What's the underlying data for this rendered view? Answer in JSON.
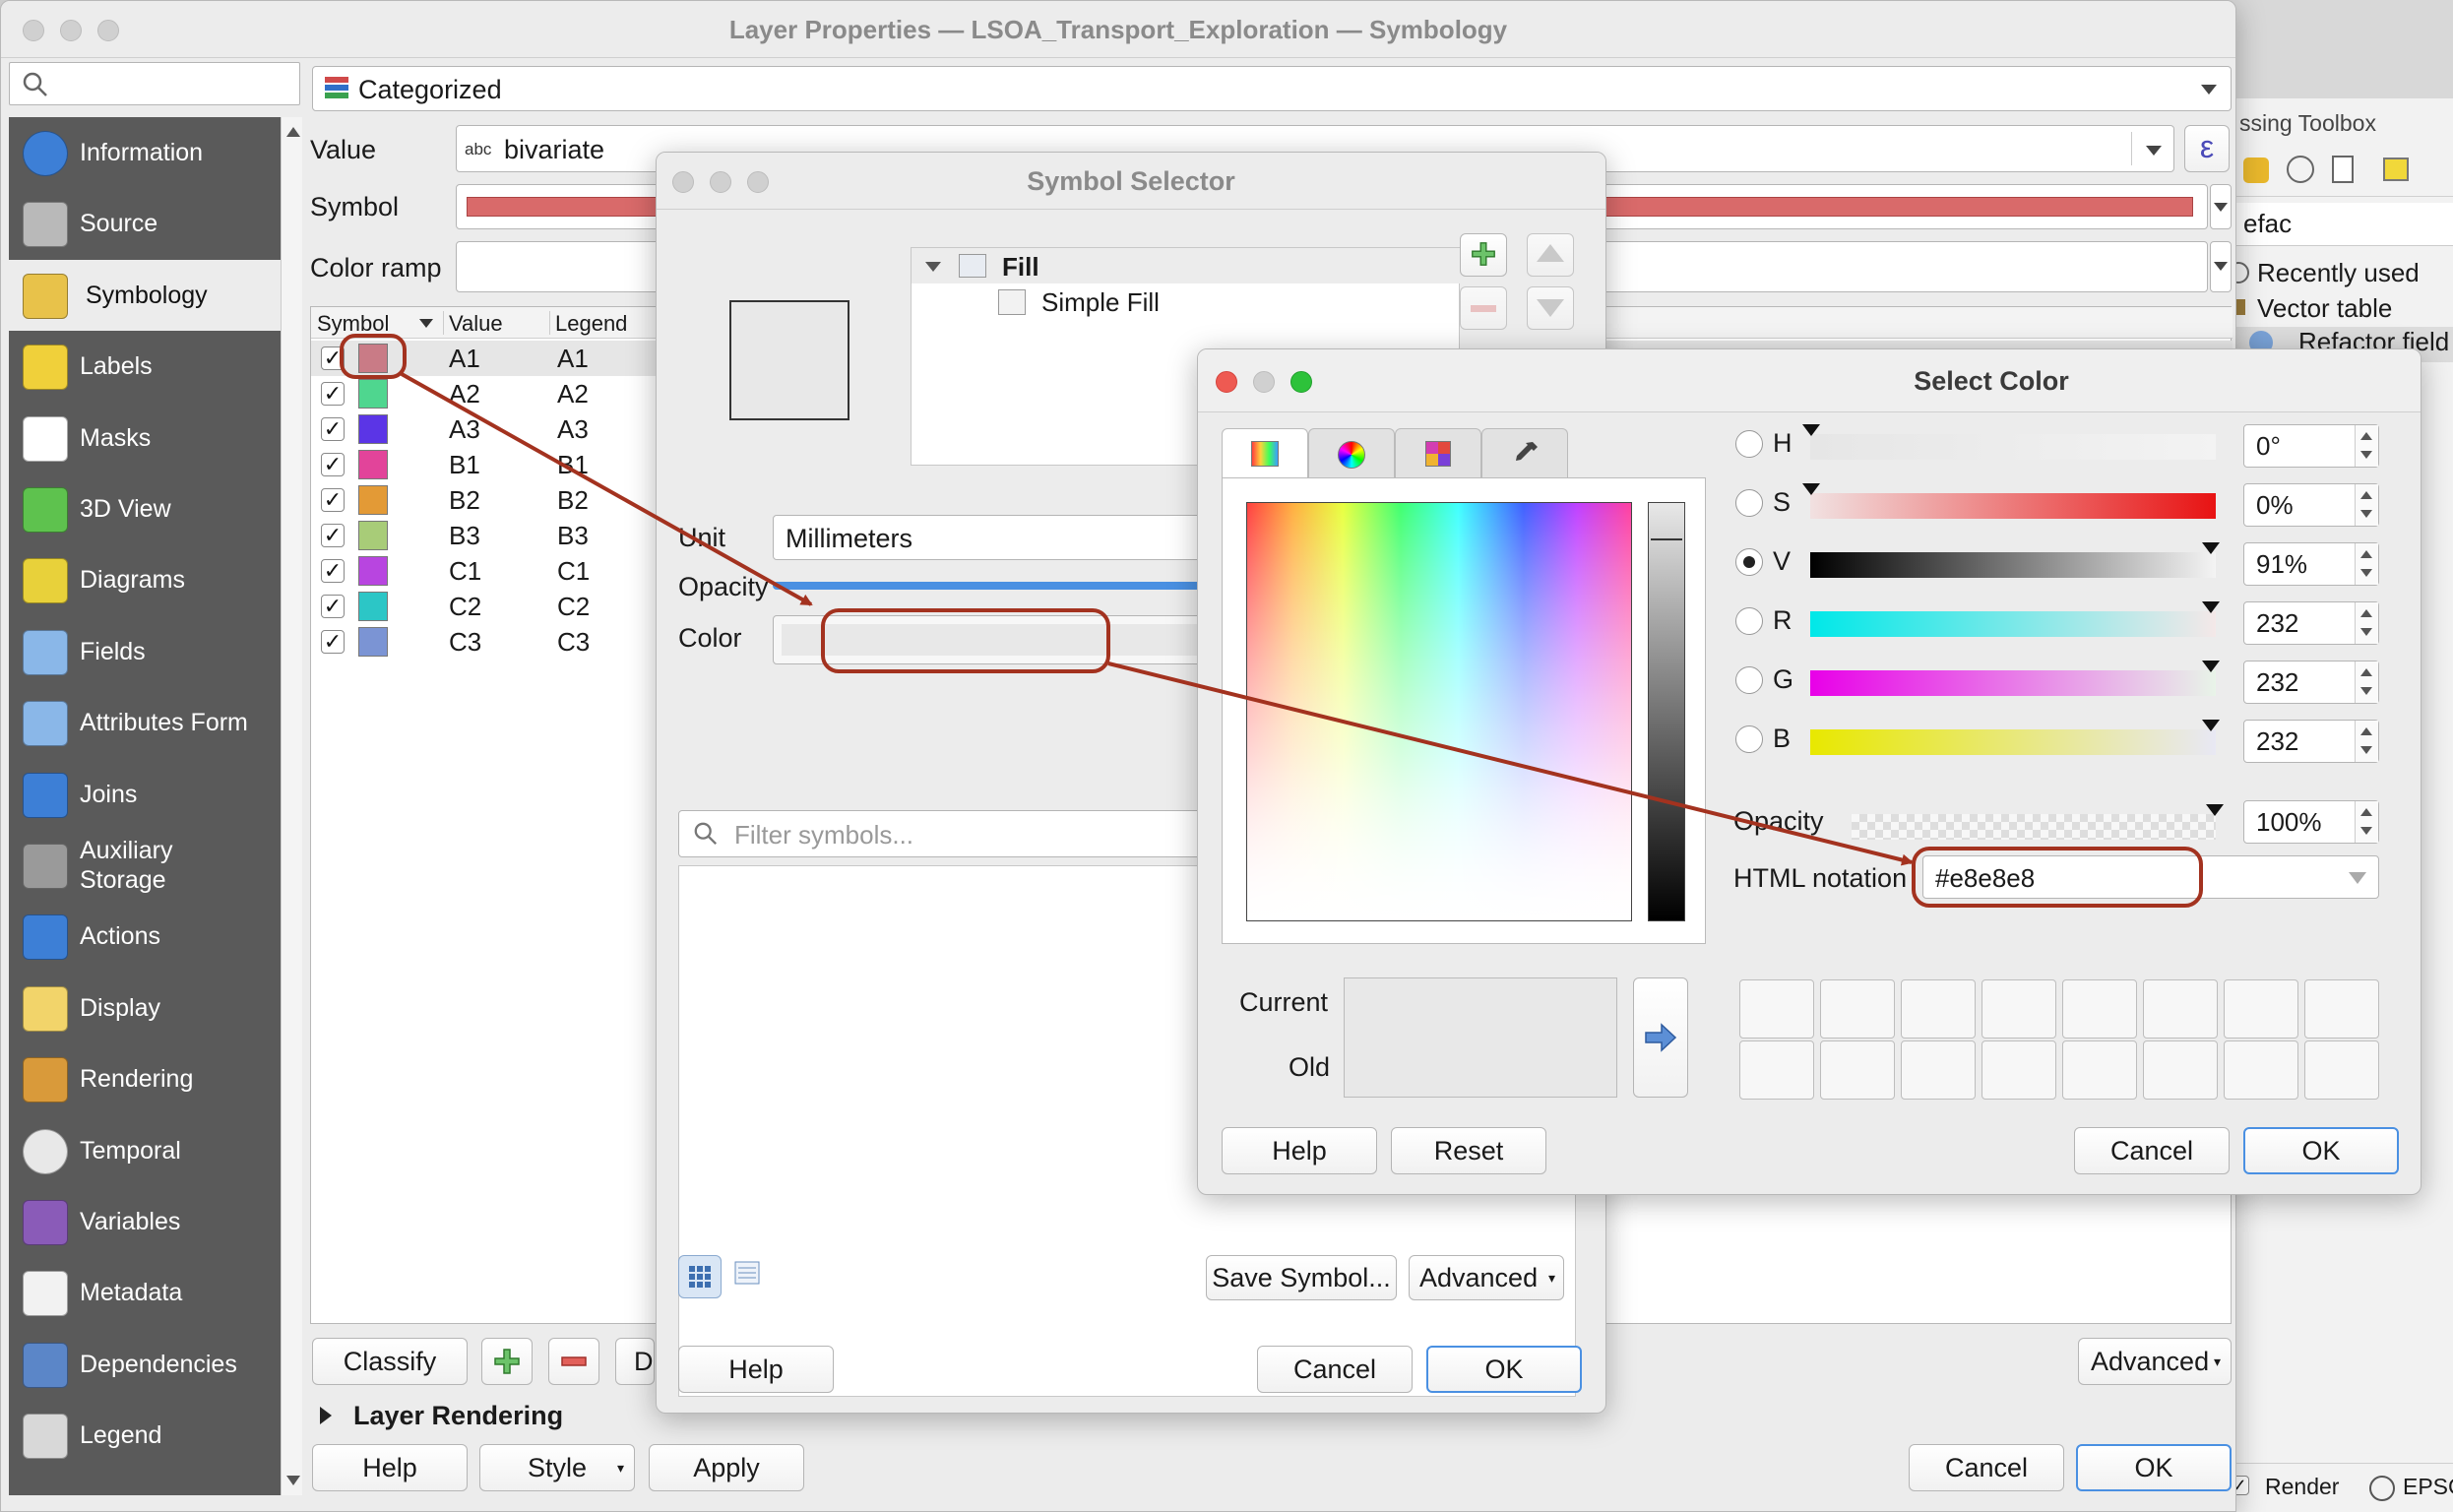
{
  "layer_props": {
    "title": "Layer Properties — LSOA_Transport_Exploration — Symbology",
    "renderer": "Categorized",
    "value_label": "Value",
    "value_field": "bivariate",
    "value_field_icon": "abc",
    "symbol_label": "Symbol",
    "color_ramp_label": "Color ramp",
    "table_headers": [
      "Symbol",
      "Value",
      "Legend"
    ],
    "rows": [
      {
        "value": "A1",
        "legend": "A1",
        "color": "#c97b86"
      },
      {
        "value": "A2",
        "legend": "A2",
        "color": "#4fd68f"
      },
      {
        "value": "A3",
        "legend": "A3",
        "color": "#5b35e6"
      },
      {
        "value": "B1",
        "legend": "B1",
        "color": "#e2449a"
      },
      {
        "value": "B2",
        "legend": "B2",
        "color": "#e39a36"
      },
      {
        "value": "B3",
        "legend": "B3",
        "color": "#a8cc78"
      },
      {
        "value": "C1",
        "legend": "C1",
        "color": "#b845e0"
      },
      {
        "value": "C2",
        "legend": "C2",
        "color": "#2cc6c6"
      },
      {
        "value": "C3",
        "legend": "C3",
        "color": "#7b94d4"
      }
    ],
    "classify_label": "Classify",
    "delete_all_label": "De",
    "layer_rendering_label": "Layer Rendering",
    "advanced_label": "Advanced",
    "help_label": "Help",
    "style_label": "Style",
    "apply_label": "Apply",
    "cancel_label": "Cancel",
    "ok_label": "OK"
  },
  "sidebar": {
    "items": [
      {
        "label": "Information",
        "icon": "information-icon"
      },
      {
        "label": "Source",
        "icon": "source-icon"
      },
      {
        "label": "Symbology",
        "icon": "symbology-icon"
      },
      {
        "label": "Labels",
        "icon": "labels-icon"
      },
      {
        "label": "Masks",
        "icon": "masks-icon"
      },
      {
        "label": "3D View",
        "icon": "3d-view-icon"
      },
      {
        "label": "Diagrams",
        "icon": "diagrams-icon"
      },
      {
        "label": "Fields",
        "icon": "fields-icon"
      },
      {
        "label": "Attributes Form",
        "icon": "attributes-form-icon"
      },
      {
        "label": "Joins",
        "icon": "joins-icon"
      },
      {
        "label": "Auxiliary\nStorage",
        "icon": "auxiliary-storage-icon"
      },
      {
        "label": "Actions",
        "icon": "actions-icon"
      },
      {
        "label": "Display",
        "icon": "display-icon"
      },
      {
        "label": "Rendering",
        "icon": "rendering-icon"
      },
      {
        "label": "Temporal",
        "icon": "temporal-icon"
      },
      {
        "label": "Variables",
        "icon": "variables-icon"
      },
      {
        "label": "Metadata",
        "icon": "metadata-icon"
      },
      {
        "label": "Dependencies",
        "icon": "dependencies-icon"
      },
      {
        "label": "Legend",
        "icon": "legend-icon"
      }
    ]
  },
  "toolbox": {
    "title_fragment": "ssing Toolbox",
    "search_fragment": "efac",
    "items": [
      "Recently used",
      "Vector table",
      "Refactor field"
    ],
    "status_render": "Render",
    "status_epsg": "EPSG"
  },
  "symbol_selector": {
    "title": "Symbol Selector",
    "tree_fill": "Fill",
    "tree_simple_fill": "Simple Fill",
    "unit_label": "Unit",
    "unit_value": "Millimeters",
    "opacity_label": "Opacity",
    "color_label": "Color",
    "filter_placeholder": "Filter symbols...",
    "save_symbol_label": "Save Symbol...",
    "advanced_label": "Advanced",
    "help_label": "Help",
    "cancel_label": "Cancel",
    "ok_label": "OK"
  },
  "select_color": {
    "title": "Select Color",
    "channels": [
      {
        "name": "H",
        "value": "0°"
      },
      {
        "name": "S",
        "value": "0%"
      },
      {
        "name": "V",
        "value": "91%"
      },
      {
        "name": "R",
        "value": "232"
      },
      {
        "name": "G",
        "value": "232"
      },
      {
        "name": "B",
        "value": "232"
      }
    ],
    "opacity_label": "Opacity",
    "opacity_value": "100%",
    "html_label": "HTML notation",
    "html_value": "#e8e8e8",
    "current_label": "Current",
    "old_label": "Old",
    "help_label": "Help",
    "reset_label": "Reset",
    "cancel_label": "Cancel",
    "ok_label": "OK",
    "current_color": "#e8e8e8"
  },
  "colors": {
    "annotation": "#a3321f",
    "sidebar_bg": "#5a5a5a",
    "accent": "#4a90e2"
  }
}
